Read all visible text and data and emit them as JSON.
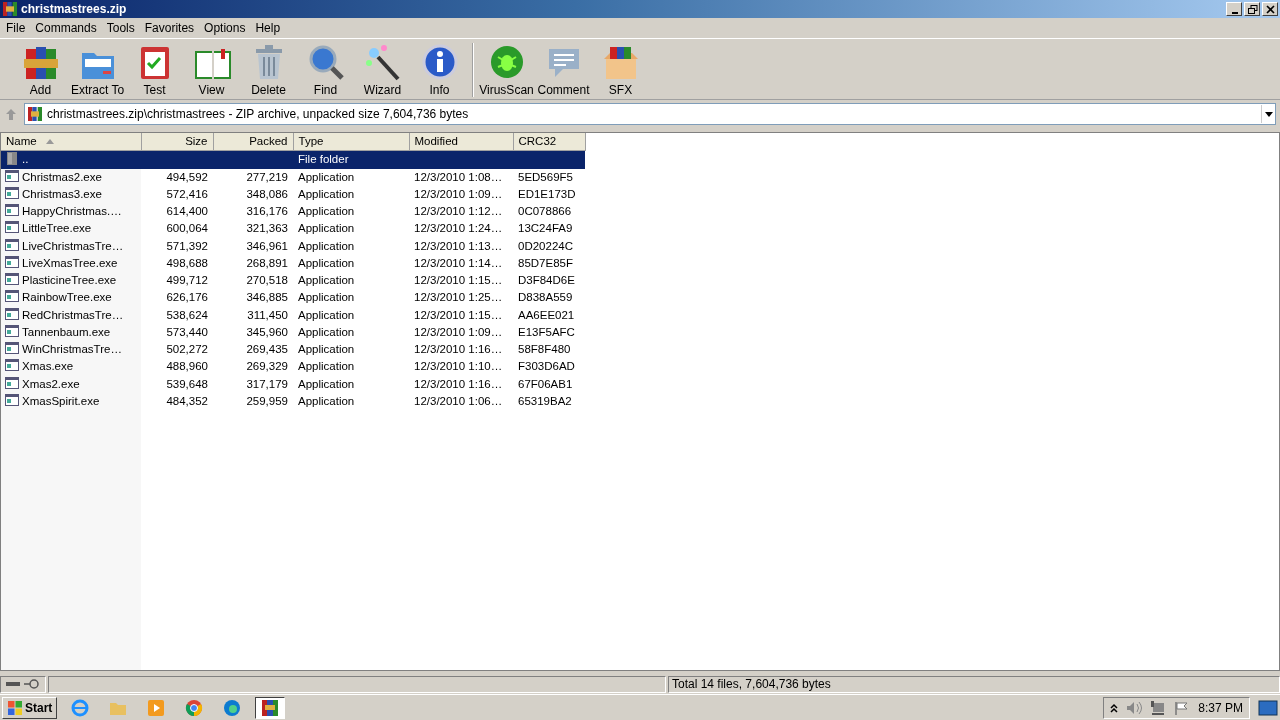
{
  "window": {
    "title": "christmastrees.zip"
  },
  "menu": [
    "File",
    "Commands",
    "Tools",
    "Favorites",
    "Options",
    "Help"
  ],
  "toolbar": [
    {
      "label": "Add",
      "separator_before": false
    },
    {
      "label": "Extract To",
      "separator_before": false
    },
    {
      "label": "Test",
      "separator_before": false
    },
    {
      "label": "View",
      "separator_before": false
    },
    {
      "label": "Delete",
      "separator_before": false
    },
    {
      "label": "Find",
      "separator_before": false
    },
    {
      "label": "Wizard",
      "separator_before": false
    },
    {
      "label": "Info",
      "separator_before": false
    },
    {
      "label": "VirusScan",
      "separator_before": true
    },
    {
      "label": "Comment",
      "separator_before": false
    },
    {
      "label": "SFX",
      "separator_before": false
    }
  ],
  "address": {
    "path": "christmastrees.zip\\christmastrees - ZIP archive, unpacked size 7,604,736 bytes"
  },
  "table": {
    "columns": [
      {
        "label": "Name",
        "sorted": true
      },
      {
        "label": "Size",
        "sorted": false
      },
      {
        "label": "Packed",
        "sorted": false
      },
      {
        "label": "Type",
        "sorted": false
      },
      {
        "label": "Modified",
        "sorted": false
      },
      {
        "label": "CRC32",
        "sorted": false
      }
    ],
    "rows": [
      {
        "kind": "folder",
        "selected": true,
        "cells": [
          "..",
          "",
          "",
          "File folder",
          "",
          ""
        ]
      },
      {
        "kind": "file",
        "selected": false,
        "cells": [
          "Christmas2.exe",
          "494,592",
          "277,219",
          "Application",
          "12/3/2010 1:08…",
          "5ED569F5"
        ]
      },
      {
        "kind": "file",
        "selected": false,
        "cells": [
          "Christmas3.exe",
          "572,416",
          "348,086",
          "Application",
          "12/3/2010 1:09…",
          "ED1E173D"
        ]
      },
      {
        "kind": "file",
        "selected": false,
        "cells": [
          "HappyChristmas.…",
          "614,400",
          "316,176",
          "Application",
          "12/3/2010 1:12…",
          "0C078866"
        ]
      },
      {
        "kind": "file",
        "selected": false,
        "cells": [
          "LittleTree.exe",
          "600,064",
          "321,363",
          "Application",
          "12/3/2010 1:24…",
          "13C24FA9"
        ]
      },
      {
        "kind": "file",
        "selected": false,
        "cells": [
          "LiveChristmasTre…",
          "571,392",
          "346,961",
          "Application",
          "12/3/2010 1:13…",
          "0D20224C"
        ]
      },
      {
        "kind": "file",
        "selected": false,
        "cells": [
          "LiveXmasTree.exe",
          "498,688",
          "268,891",
          "Application",
          "12/3/2010 1:14…",
          "85D7E85F"
        ]
      },
      {
        "kind": "file",
        "selected": false,
        "cells": [
          "PlasticineTree.exe",
          "499,712",
          "270,518",
          "Application",
          "12/3/2010 1:15…",
          "D3F84D6E"
        ]
      },
      {
        "kind": "file",
        "selected": false,
        "cells": [
          "RainbowTree.exe",
          "626,176",
          "346,885",
          "Application",
          "12/3/2010 1:25…",
          "D838A559"
        ]
      },
      {
        "kind": "file",
        "selected": false,
        "cells": [
          "RedChristmasTre…",
          "538,624",
          "311,450",
          "Application",
          "12/3/2010 1:15…",
          "AA6EE021"
        ]
      },
      {
        "kind": "file",
        "selected": false,
        "cells": [
          "Tannenbaum.exe",
          "573,440",
          "345,960",
          "Application",
          "12/3/2010 1:09…",
          "E13F5AFC"
        ]
      },
      {
        "kind": "file",
        "selected": false,
        "cells": [
          "WinChristmasTre…",
          "502,272",
          "269,435",
          "Application",
          "12/3/2010 1:16…",
          "58F8F480"
        ]
      },
      {
        "kind": "file",
        "selected": false,
        "cells": [
          "Xmas.exe",
          "488,960",
          "269,329",
          "Application",
          "12/3/2010 1:10…",
          "F303D6AD"
        ]
      },
      {
        "kind": "file",
        "selected": false,
        "cells": [
          "Xmas2.exe",
          "539,648",
          "317,179",
          "Application",
          "12/3/2010 1:16…",
          "67F06AB1"
        ]
      },
      {
        "kind": "file",
        "selected": false,
        "cells": [
          "XmasSpirit.exe",
          "484,352",
          "259,959",
          "Application",
          "12/3/2010 1:06…",
          "65319BA2"
        ]
      }
    ]
  },
  "status_bar": {
    "total": "Total 14 files, 7,604,736 bytes"
  },
  "taskbar": {
    "start": "Start",
    "apps": [
      {
        "selected": false
      },
      {
        "selected": false
      },
      {
        "selected": false
      },
      {
        "selected": false
      },
      {
        "selected": false
      },
      {
        "selected": true
      }
    ],
    "clock": "8:37 PM"
  }
}
